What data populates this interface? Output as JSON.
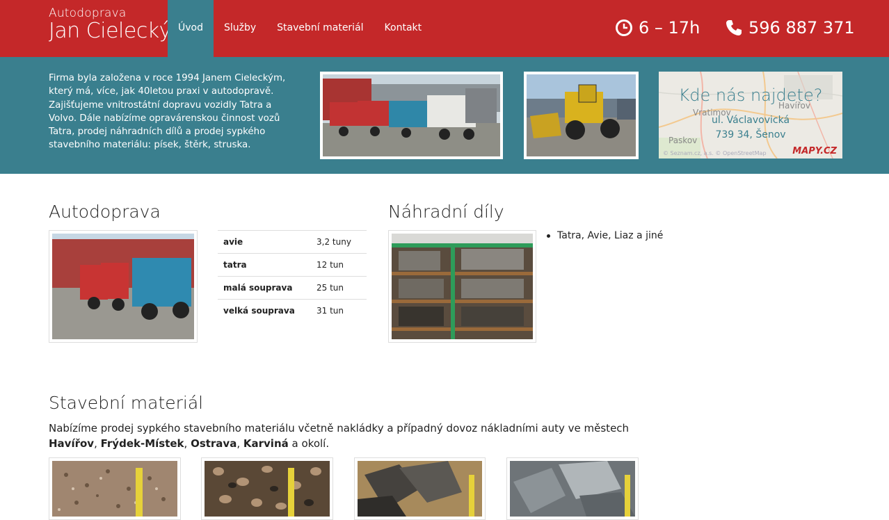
{
  "header": {
    "brand_small": "Autodoprava",
    "brand_large": "Jan Cielecký",
    "nav": [
      {
        "label": "Úvod",
        "active": true
      },
      {
        "label": "Služby",
        "active": false
      },
      {
        "label": "Stavební materiál",
        "active": false
      },
      {
        "label": "Kontakt",
        "active": false
      }
    ],
    "hours": "6 – 17h",
    "phone": "596 887 371",
    "hours_icon": "clock-icon",
    "phone_icon": "phone-icon"
  },
  "intro": {
    "text": "Firma byla založena v roce 1994 Janem Cieleckým, který má, více, jak 40letou praxi v autodopravě. Zajišťujeme vnitrostátní dopravu vozidly Tatra a Volvo. Dále nabízíme opravárenskou činnost vozů Tatra, prodej náhradních dílů a prodej sypkého stavebního materiálu: písek, štěrk, struska."
  },
  "map": {
    "title": "Kde nás najdete?",
    "street": "ul. Václavovická",
    "city": "739 34, Šenov",
    "places": [
      "Vratimov",
      "Havířov",
      "Paskov"
    ],
    "credit": "© Seznam.cz, a.s. © OpenStreetMap",
    "logo": "MAPY.CZ"
  },
  "autodoprava": {
    "title": "Autodoprava",
    "rows": [
      {
        "name": "avie",
        "value": "3,2 tuny"
      },
      {
        "name": "tatra",
        "value": "12 tun"
      },
      {
        "name": "malá souprava",
        "value": "25 tun"
      },
      {
        "name": "velká souprava",
        "value": "31 tun"
      }
    ]
  },
  "nahradni": {
    "title": "Náhradní díly",
    "items": [
      "Tatra, Avie, Liaz a jiné"
    ]
  },
  "material": {
    "title": "Stavební materiál",
    "text_before": "Nabízíme prodej sypkého stavebního materiálu včetně nakládky a případný dovoz nákladními auty ve městech ",
    "city1": "Havířov",
    "sep1": ", ",
    "city2": "Frýdek-Místek",
    "sep2": ", ",
    "city3": "Ostrava",
    "sep3": ", ",
    "city4": "Karviná",
    "text_after": " a okolí."
  },
  "colors": {
    "header_red": "#c42829",
    "teal": "#3a7f8e"
  }
}
